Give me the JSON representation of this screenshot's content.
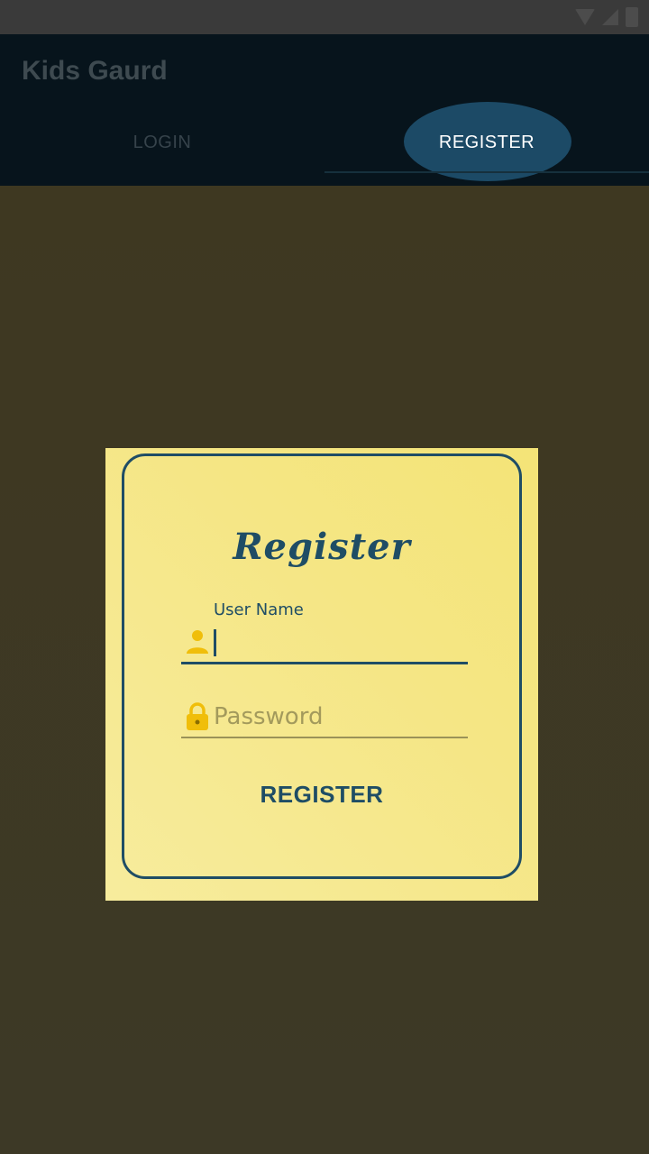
{
  "app": {
    "title": "Kids Gaurd"
  },
  "tabs": [
    {
      "label": "LOGIN",
      "selected": false
    },
    {
      "label": "REGISTER",
      "selected": true
    }
  ],
  "form": {
    "title": "Register",
    "username": {
      "label": "User Name",
      "value": "",
      "icon": "person-icon"
    },
    "password": {
      "placeholder": "Password",
      "value": "",
      "icon": "lock-icon"
    },
    "submit_label": "REGISTER"
  },
  "colors": {
    "app_bar": "#07141c",
    "accent": "#1f4d65",
    "icon_yellow": "#f0be0a",
    "card_bg": "#f6e98f"
  }
}
